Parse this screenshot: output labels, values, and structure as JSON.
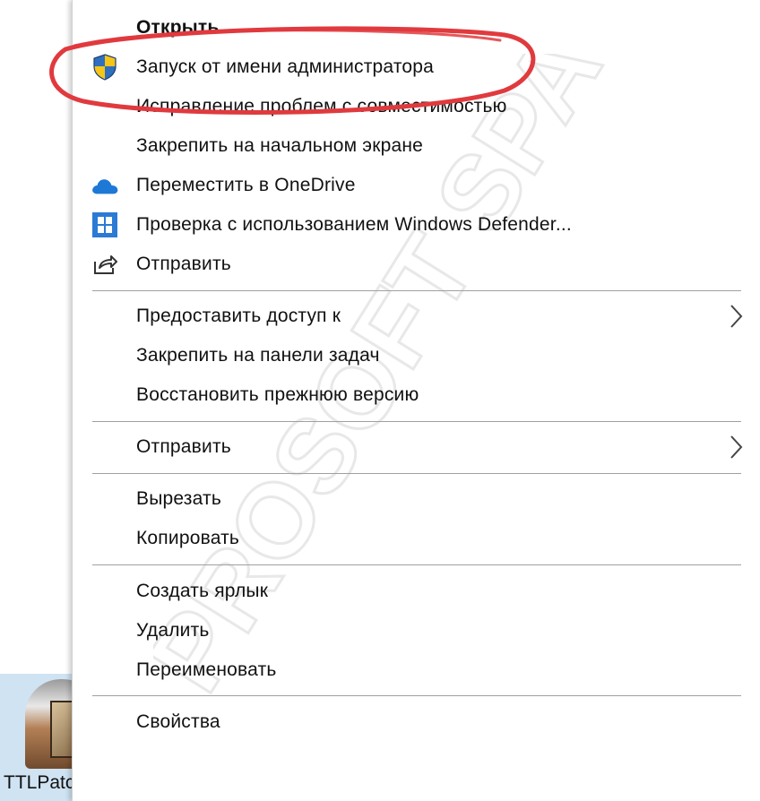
{
  "desktop": {
    "file_name": "TTLPatch.exe"
  },
  "context_menu": {
    "items": [
      {
        "label": "Открыть",
        "icon": "",
        "bold": true
      },
      {
        "label": "Запуск от имени администратора",
        "icon": "uac-shield-icon"
      },
      {
        "label": "Исправление проблем с совместимостью",
        "icon": ""
      },
      {
        "label": "Закрепить на начальном экране",
        "icon": ""
      },
      {
        "label": "Переместить в OneDrive",
        "icon": "onedrive-cloud-icon"
      },
      {
        "label": "Проверка с использованием Windows Defender...",
        "icon": "windows-defender-icon"
      },
      {
        "label": "Отправить",
        "icon": "share-icon"
      },
      {
        "label": "Предоставить доступ к",
        "icon": "",
        "submenu": true
      },
      {
        "label": "Закрепить на панели задач",
        "icon": ""
      },
      {
        "label": "Восстановить прежнюю версию",
        "icon": ""
      },
      {
        "label": "Отправить",
        "icon": "",
        "submenu": true
      },
      {
        "label": "Вырезать",
        "icon": ""
      },
      {
        "label": "Копировать",
        "icon": ""
      },
      {
        "label": "Создать ярлык",
        "icon": ""
      },
      {
        "label": "Удалить",
        "icon": ""
      },
      {
        "label": "Переименовать",
        "icon": ""
      },
      {
        "label": "Свойства",
        "icon": ""
      }
    ]
  },
  "highlight": {
    "color": "#e03a3e",
    "target": "Запуск от имени администратора"
  },
  "watermark": {
    "text": "PROSOFT SPACE",
    "color": "#e6e6e6"
  }
}
